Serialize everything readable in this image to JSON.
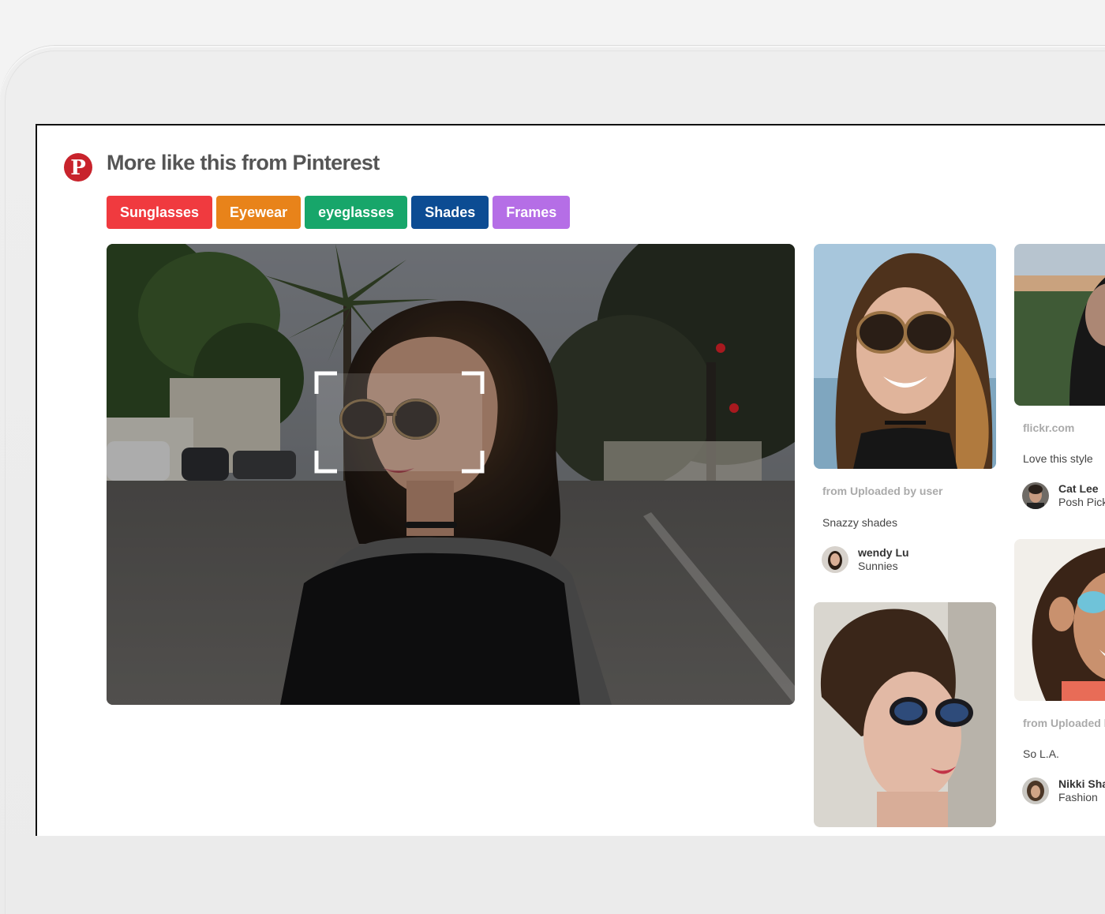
{
  "header": {
    "logo_glyph": "P",
    "title": "More like this from Pinterest"
  },
  "tags": [
    {
      "label": "Sunglasses",
      "color": "#f03a3f"
    },
    {
      "label": "Eyewear",
      "color": "#e8831a"
    },
    {
      "label": "eyeglasses",
      "color": "#17a66a"
    },
    {
      "label": "Shades",
      "color": "#0c4c93"
    },
    {
      "label": "Frames",
      "color": "#b56ee6"
    }
  ],
  "pins": [
    {
      "source": "from Uploaded by user",
      "description": "Snazzy shades",
      "user": "wendy Lu",
      "board": "Sunnies"
    },
    {
      "source": "flickr.com",
      "description": "Love this style",
      "user": "Cat Lee",
      "board": "Posh Picks"
    },
    {
      "source": "from Uploaded by user",
      "description": "So L.A.",
      "user": "Nikki Shaw",
      "board": "Fashion"
    }
  ],
  "colors": {
    "brand": "#c8232c",
    "title": "#555555"
  },
  "icons": {
    "logo": "pinterest-logo-icon",
    "crop": "visual-search-crop-icon"
  }
}
